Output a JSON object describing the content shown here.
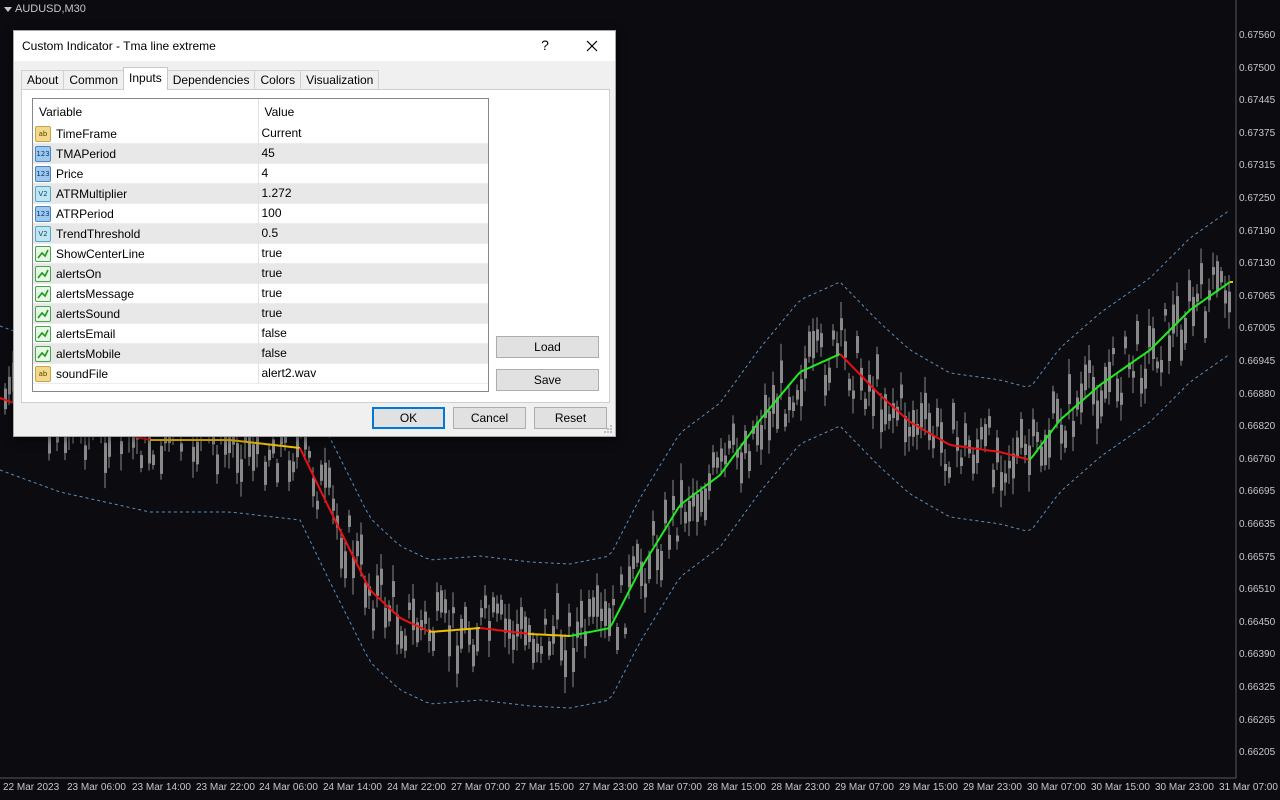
{
  "chart": {
    "symbol_label": "AUDUSD,M30",
    "colors": {
      "background": "#0b0b10",
      "candles": "#8a8a8a",
      "bands": "#5b8fbf",
      "tma_up": "#22ee22",
      "tma_down": "#ee1111",
      "tma_flat": "#f2c200",
      "axis_text": "#c8c8c8"
    },
    "price_axis": [
      "0.67560",
      "0.67500",
      "0.67445",
      "0.67375",
      "0.67315",
      "0.67250",
      "0.67190",
      "0.67130",
      "0.67065",
      "0.67005",
      "0.66945",
      "0.66880",
      "0.66820",
      "0.66760",
      "0.66695",
      "0.66635",
      "0.66575",
      "0.66510",
      "0.66450",
      "0.66390",
      "0.66325",
      "0.66265",
      "0.66205"
    ],
    "time_axis": [
      "22 Mar 2023",
      "23 Mar 06:00",
      "23 Mar 14:00",
      "23 Mar 22:00",
      "24 Mar 06:00",
      "24 Mar 14:00",
      "24 Mar 22:00",
      "27 Mar 07:00",
      "27 Mar 15:00",
      "27 Mar 23:00",
      "28 Mar 07:00",
      "28 Mar 15:00",
      "28 Mar 23:00",
      "29 Mar 07:00",
      "29 Mar 15:00",
      "29 Mar 23:00",
      "30 Mar 07:00",
      "30 Mar 15:00",
      "30 Mar 23:00",
      "31 Mar 07:00"
    ]
  },
  "dialog": {
    "title": "Custom Indicator - Tma line extreme",
    "help_label": "?",
    "tabs": [
      {
        "label": "About"
      },
      {
        "label": "Common"
      },
      {
        "label": "Inputs"
      },
      {
        "label": "Dependencies"
      },
      {
        "label": "Colors"
      },
      {
        "label": "Visualization"
      }
    ],
    "active_tab": "Inputs",
    "columns": {
      "variable": "Variable",
      "value": "Value"
    },
    "inputs": [
      {
        "type_icon": "ab",
        "icon_name": "string-type-icon",
        "variable": "TimeFrame",
        "value": "Current"
      },
      {
        "type_icon": "123",
        "icon_name": "integer-type-icon",
        "variable": "TMAPeriod",
        "value": "45"
      },
      {
        "type_icon": "123",
        "icon_name": "integer-type-icon",
        "variable": "Price",
        "value": "4"
      },
      {
        "type_icon": "V2",
        "icon_name": "double-type-icon",
        "variable": "ATRMultiplier",
        "value": "1.272"
      },
      {
        "type_icon": "123",
        "icon_name": "integer-type-icon",
        "variable": "ATRPeriod",
        "value": "100"
      },
      {
        "type_icon": "V2",
        "icon_name": "double-type-icon",
        "variable": "TrendThreshold",
        "value": "0.5"
      },
      {
        "type_icon": "",
        "icon_name": "bool-type-icon",
        "variable": "ShowCenterLine",
        "value": "true"
      },
      {
        "type_icon": "",
        "icon_name": "bool-type-icon",
        "variable": "alertsOn",
        "value": "true"
      },
      {
        "type_icon": "",
        "icon_name": "bool-type-icon",
        "variable": "alertsMessage",
        "value": "true"
      },
      {
        "type_icon": "",
        "icon_name": "bool-type-icon",
        "variable": "alertsSound",
        "value": "true"
      },
      {
        "type_icon": "",
        "icon_name": "bool-type-icon",
        "variable": "alertsEmail",
        "value": "false"
      },
      {
        "type_icon": "",
        "icon_name": "bool-type-icon",
        "variable": "alertsMobile",
        "value": "false"
      },
      {
        "type_icon": "ab",
        "icon_name": "string-type-icon",
        "variable": "soundFile",
        "value": "alert2.wav"
      }
    ],
    "buttons": {
      "load": "Load",
      "save": "Save",
      "ok": "OK",
      "cancel": "Cancel",
      "reset": "Reset"
    }
  }
}
